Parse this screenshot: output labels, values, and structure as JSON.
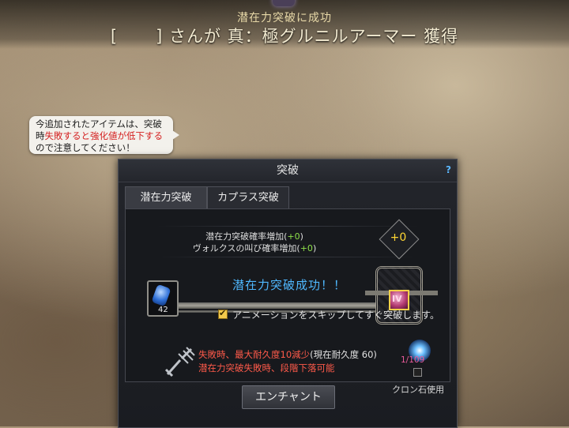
{
  "notice": {
    "subtitle": "潜在力突破に成功",
    "bracket_open": "[",
    "message": "] さんが 真：極グルニルアーマー 獲得"
  },
  "tooltip": {
    "part1": "今追加されたアイテムは、突破時",
    "warning": "失敗すると強化値が低下する",
    "part2": "ので注意してください！"
  },
  "window": {
    "title": "突破",
    "help": "?",
    "tabs": [
      {
        "label": "潜在力突破",
        "active": true
      },
      {
        "label": "カプラス突破",
        "active": false
      }
    ],
    "rates": {
      "line1_label": "潜在力突破確率増加(",
      "line1_value": "+0",
      "line1_close": ")",
      "line2_label": "ヴォルクスの叫び確率増加(",
      "line2_value": "+0",
      "line2_close": ")"
    },
    "enhance_level": "+0",
    "success_text": "潜在力突破成功！！",
    "material_count": "42",
    "item_grade": "IV",
    "skip_animation": {
      "label": "アニメーションをスキップしてすぐ突破します。",
      "checked": true
    },
    "fail_line1_red": "失敗時、最大耐久度10減少",
    "fail_line1_white": "(現在耐久度 60)",
    "fail_line2": "潜在力突破失敗時、段階下落可能",
    "crone": {
      "count": "1/109",
      "label": "クロン石使用",
      "checked": false
    },
    "enchant_button": "エンチャント"
  },
  "colors": {
    "accent_blue": "#4fb8ff",
    "warning_red": "#ff5a4a",
    "bonus_green": "#8ee04a",
    "gold": "#ffd633"
  }
}
